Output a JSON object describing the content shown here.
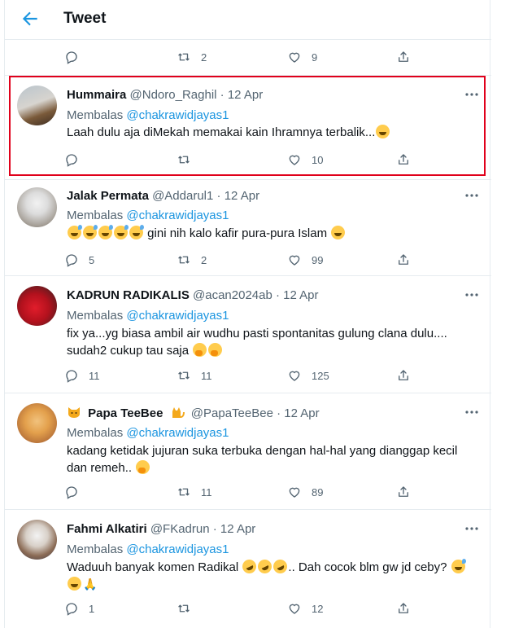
{
  "header": {
    "title": "Tweet"
  },
  "top_actions": {
    "retweets": "2",
    "likes": "9"
  },
  "reply_prefix": "Membalas",
  "tweets": [
    {
      "name": "Hummaira",
      "handle": "@Ndoro_Raghil",
      "dot": "·",
      "date": "12 Apr",
      "reply_to": "@chakrawidjayas1",
      "text": "Laah dulu aja diMekah memakai kain Ihramnya terbalik...",
      "replies": "",
      "retweets": "",
      "likes": "10"
    },
    {
      "name": "Jalak Permata",
      "handle": "@Addarul1",
      "dot": "·",
      "date": "12 Apr",
      "reply_to": "@chakrawidjayas1",
      "text": "gini nih kalo kafir pura-pura Islam",
      "replies": "5",
      "retweets": "2",
      "likes": "99"
    },
    {
      "name": "KADRUN RADIKALIS",
      "handle": "@acan2024ab",
      "dot": "·",
      "date": "12 Apr",
      "reply_to": "@chakrawidjayas1",
      "text_line1": "fix ya...yg biasa ambil air wudhu pasti spontanitas gulung clana dulu....",
      "text_line2": "sudah2 cukup tau saja",
      "replies": "11",
      "retweets": "11",
      "likes": "125"
    },
    {
      "name": "Papa TeeBee",
      "handle": "@PapaTeeBee",
      "dot": "·",
      "date": "12 Apr",
      "reply_to": "@chakrawidjayas1",
      "text_line1": "kadang ketidak jujuran suka terbuka dengan hal-hal yang dianggap kecil",
      "text_line2": "dan remeh..",
      "replies": "",
      "retweets": "11",
      "likes": "89"
    },
    {
      "name": "Fahmi Alkatiri",
      "handle": "@FKadrun",
      "dot": "·",
      "date": "12 Apr",
      "reply_to": "@chakrawidjayas1",
      "text_line1a": "Waduuh banyak komen Radikal",
      "text_line1b": ".. Dah cocok blm gw jd ceby?",
      "replies": "1",
      "retweets": "",
      "likes": "12"
    }
  ],
  "colors": {
    "accent": "#1b95e0",
    "highlight": "#e0001b",
    "muted": "#536471"
  }
}
